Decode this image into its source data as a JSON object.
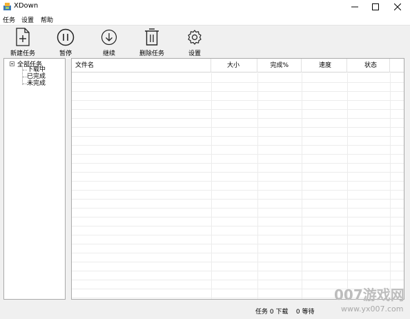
{
  "window": {
    "title": "XDown"
  },
  "menu": [
    "任务",
    "设置",
    "帮助"
  ],
  "toolbar": {
    "new_task": "新建任务",
    "pause": "暂停",
    "resume": "继续",
    "delete_task": "删除任务",
    "settings": "设置"
  },
  "tree": {
    "root": "全部任务",
    "children": [
      "下载中",
      "已完成",
      "未完成"
    ]
  },
  "list": {
    "columns": [
      "文件名",
      "大小",
      "完成%",
      "速度",
      "状态"
    ],
    "rows": []
  },
  "status": {
    "text": "任务 0 下载    0 等待"
  },
  "watermark": {
    "text": "007游戏网",
    "url": "www.yx007.com"
  },
  "icons": {
    "new_task": "file-plus-icon",
    "pause": "pause-circle-icon",
    "resume": "download-circle-icon",
    "delete_task": "trash-icon",
    "settings": "gear-icon"
  }
}
